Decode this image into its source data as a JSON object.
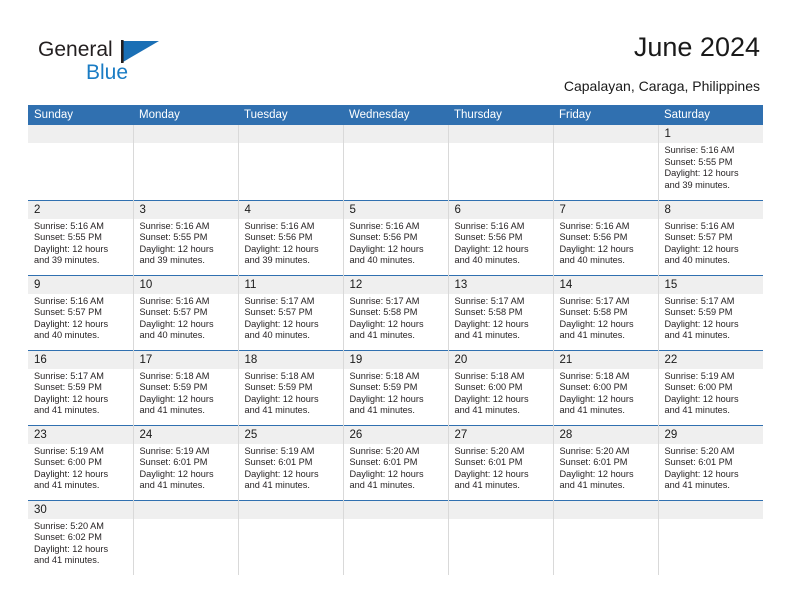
{
  "brand": {
    "name_top": "General",
    "name_bottom": "Blue",
    "accent_color": "#1a7cc4",
    "flag_icon": "blue-triangle-flag-icon"
  },
  "header": {
    "title": "June 2024",
    "subtitle": "Capalayan, Caraga, Philippines"
  },
  "calendar": {
    "header_bg": "#3070b0",
    "daynum_bg": "#efefef",
    "weekday_headers": [
      "Sunday",
      "Monday",
      "Tuesday",
      "Wednesday",
      "Thursday",
      "Friday",
      "Saturday"
    ],
    "weeks": [
      [
        {
          "day": "",
          "empty": true
        },
        {
          "day": "",
          "empty": true
        },
        {
          "day": "",
          "empty": true
        },
        {
          "day": "",
          "empty": true
        },
        {
          "day": "",
          "empty": true
        },
        {
          "day": "",
          "empty": true
        },
        {
          "day": "1",
          "sunrise": "Sunrise: 5:16 AM",
          "sunset": "Sunset: 5:55 PM",
          "daylight1": "Daylight: 12 hours",
          "daylight2": "and 39 minutes."
        }
      ],
      [
        {
          "day": "2",
          "sunrise": "Sunrise: 5:16 AM",
          "sunset": "Sunset: 5:55 PM",
          "daylight1": "Daylight: 12 hours",
          "daylight2": "and 39 minutes."
        },
        {
          "day": "3",
          "sunrise": "Sunrise: 5:16 AM",
          "sunset": "Sunset: 5:55 PM",
          "daylight1": "Daylight: 12 hours",
          "daylight2": "and 39 minutes."
        },
        {
          "day": "4",
          "sunrise": "Sunrise: 5:16 AM",
          "sunset": "Sunset: 5:56 PM",
          "daylight1": "Daylight: 12 hours",
          "daylight2": "and 39 minutes."
        },
        {
          "day": "5",
          "sunrise": "Sunrise: 5:16 AM",
          "sunset": "Sunset: 5:56 PM",
          "daylight1": "Daylight: 12 hours",
          "daylight2": "and 40 minutes."
        },
        {
          "day": "6",
          "sunrise": "Sunrise: 5:16 AM",
          "sunset": "Sunset: 5:56 PM",
          "daylight1": "Daylight: 12 hours",
          "daylight2": "and 40 minutes."
        },
        {
          "day": "7",
          "sunrise": "Sunrise: 5:16 AM",
          "sunset": "Sunset: 5:56 PM",
          "daylight1": "Daylight: 12 hours",
          "daylight2": "and 40 minutes."
        },
        {
          "day": "8",
          "sunrise": "Sunrise: 5:16 AM",
          "sunset": "Sunset: 5:57 PM",
          "daylight1": "Daylight: 12 hours",
          "daylight2": "and 40 minutes."
        }
      ],
      [
        {
          "day": "9",
          "sunrise": "Sunrise: 5:16 AM",
          "sunset": "Sunset: 5:57 PM",
          "daylight1": "Daylight: 12 hours",
          "daylight2": "and 40 minutes."
        },
        {
          "day": "10",
          "sunrise": "Sunrise: 5:16 AM",
          "sunset": "Sunset: 5:57 PM",
          "daylight1": "Daylight: 12 hours",
          "daylight2": "and 40 minutes."
        },
        {
          "day": "11",
          "sunrise": "Sunrise: 5:17 AM",
          "sunset": "Sunset: 5:57 PM",
          "daylight1": "Daylight: 12 hours",
          "daylight2": "and 40 minutes."
        },
        {
          "day": "12",
          "sunrise": "Sunrise: 5:17 AM",
          "sunset": "Sunset: 5:58 PM",
          "daylight1": "Daylight: 12 hours",
          "daylight2": "and 41 minutes."
        },
        {
          "day": "13",
          "sunrise": "Sunrise: 5:17 AM",
          "sunset": "Sunset: 5:58 PM",
          "daylight1": "Daylight: 12 hours",
          "daylight2": "and 41 minutes."
        },
        {
          "day": "14",
          "sunrise": "Sunrise: 5:17 AM",
          "sunset": "Sunset: 5:58 PM",
          "daylight1": "Daylight: 12 hours",
          "daylight2": "and 41 minutes."
        },
        {
          "day": "15",
          "sunrise": "Sunrise: 5:17 AM",
          "sunset": "Sunset: 5:59 PM",
          "daylight1": "Daylight: 12 hours",
          "daylight2": "and 41 minutes."
        }
      ],
      [
        {
          "day": "16",
          "sunrise": "Sunrise: 5:17 AM",
          "sunset": "Sunset: 5:59 PM",
          "daylight1": "Daylight: 12 hours",
          "daylight2": "and 41 minutes."
        },
        {
          "day": "17",
          "sunrise": "Sunrise: 5:18 AM",
          "sunset": "Sunset: 5:59 PM",
          "daylight1": "Daylight: 12 hours",
          "daylight2": "and 41 minutes."
        },
        {
          "day": "18",
          "sunrise": "Sunrise: 5:18 AM",
          "sunset": "Sunset: 5:59 PM",
          "daylight1": "Daylight: 12 hours",
          "daylight2": "and 41 minutes."
        },
        {
          "day": "19",
          "sunrise": "Sunrise: 5:18 AM",
          "sunset": "Sunset: 5:59 PM",
          "daylight1": "Daylight: 12 hours",
          "daylight2": "and 41 minutes."
        },
        {
          "day": "20",
          "sunrise": "Sunrise: 5:18 AM",
          "sunset": "Sunset: 6:00 PM",
          "daylight1": "Daylight: 12 hours",
          "daylight2": "and 41 minutes."
        },
        {
          "day": "21",
          "sunrise": "Sunrise: 5:18 AM",
          "sunset": "Sunset: 6:00 PM",
          "daylight1": "Daylight: 12 hours",
          "daylight2": "and 41 minutes."
        },
        {
          "day": "22",
          "sunrise": "Sunrise: 5:19 AM",
          "sunset": "Sunset: 6:00 PM",
          "daylight1": "Daylight: 12 hours",
          "daylight2": "and 41 minutes."
        }
      ],
      [
        {
          "day": "23",
          "sunrise": "Sunrise: 5:19 AM",
          "sunset": "Sunset: 6:00 PM",
          "daylight1": "Daylight: 12 hours",
          "daylight2": "and 41 minutes."
        },
        {
          "day": "24",
          "sunrise": "Sunrise: 5:19 AM",
          "sunset": "Sunset: 6:01 PM",
          "daylight1": "Daylight: 12 hours",
          "daylight2": "and 41 minutes."
        },
        {
          "day": "25",
          "sunrise": "Sunrise: 5:19 AM",
          "sunset": "Sunset: 6:01 PM",
          "daylight1": "Daylight: 12 hours",
          "daylight2": "and 41 minutes."
        },
        {
          "day": "26",
          "sunrise": "Sunrise: 5:20 AM",
          "sunset": "Sunset: 6:01 PM",
          "daylight1": "Daylight: 12 hours",
          "daylight2": "and 41 minutes."
        },
        {
          "day": "27",
          "sunrise": "Sunrise: 5:20 AM",
          "sunset": "Sunset: 6:01 PM",
          "daylight1": "Daylight: 12 hours",
          "daylight2": "and 41 minutes."
        },
        {
          "day": "28",
          "sunrise": "Sunrise: 5:20 AM",
          "sunset": "Sunset: 6:01 PM",
          "daylight1": "Daylight: 12 hours",
          "daylight2": "and 41 minutes."
        },
        {
          "day": "29",
          "sunrise": "Sunrise: 5:20 AM",
          "sunset": "Sunset: 6:01 PM",
          "daylight1": "Daylight: 12 hours",
          "daylight2": "and 41 minutes."
        }
      ],
      [
        {
          "day": "30",
          "sunrise": "Sunrise: 5:20 AM",
          "sunset": "Sunset: 6:02 PM",
          "daylight1": "Daylight: 12 hours",
          "daylight2": "and 41 minutes."
        },
        {
          "day": "",
          "empty": true
        },
        {
          "day": "",
          "empty": true
        },
        {
          "day": "",
          "empty": true
        },
        {
          "day": "",
          "empty": true
        },
        {
          "day": "",
          "empty": true
        },
        {
          "day": "",
          "empty": true
        }
      ]
    ]
  }
}
